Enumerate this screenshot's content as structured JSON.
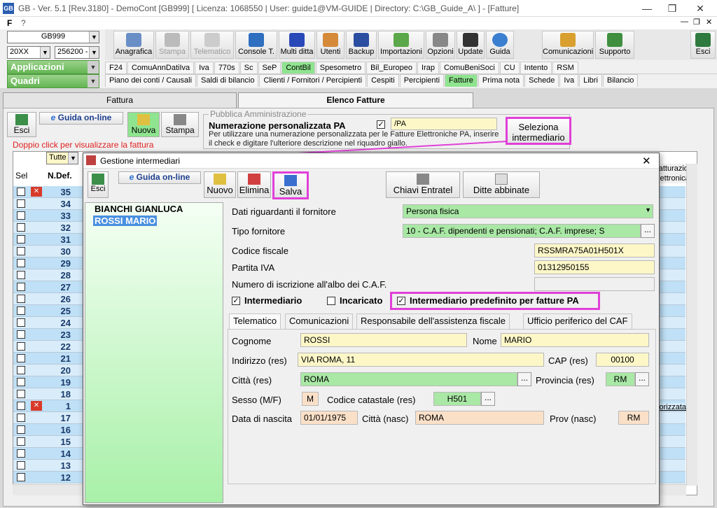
{
  "window": {
    "title": "GB - Ver. 5.1 [Rev.3180] - DemoCont [GB999]    [ Licenza: 1068550 | User: guide1@VM-GUIDE | Directory: C:\\GB_Guide_A\\ ] - [Fatture]",
    "menu_f": "F",
    "menu_q": "?"
  },
  "top_left": {
    "company": "GB999",
    "year": "20XX",
    "code": "256200 -",
    "applicazioni": "Applicazioni",
    "quadri": "Quadri"
  },
  "toolbar": [
    "Anagrafica",
    "Stampa",
    "Telematico",
    "Console T.",
    "Multi ditta",
    "Utenti",
    "Backup",
    "Importazioni",
    "Opzioni",
    "Update",
    "Guida",
    "Comunicazioni",
    "Supporto",
    "Esci"
  ],
  "tabs_row1": [
    "F24",
    "ComuAnnDatiIva",
    "Iva",
    "770s",
    "Sc",
    "SeP",
    "ContBil",
    "Spesometro",
    "Bil_Europeo",
    "Irap",
    "ComuBeniSoci",
    "CU",
    "Intento",
    "RSM"
  ],
  "tabs_row2": [
    "Piano dei conti / Causali",
    "Saldi di bilancio",
    "Clienti / Fornitori / Percipienti",
    "Cespiti",
    "Percipienti",
    "Fatture",
    "Prima nota",
    "Schede",
    "Iva",
    "Libri",
    "Bilancio"
  ],
  "main_tabs": [
    "Fattura",
    "Elenco Fatture"
  ],
  "main": {
    "esci": "Esci",
    "guida": "Guida on-line",
    "nuova": "Nuova",
    "stampa": "Stampa",
    "hint": "Doppio click per visualizzare la fattura",
    "filter": "Tutte",
    "col_sel": "Sel",
    "col_ndef": "N.Def.",
    "right_header": "Fatturazione elettronica",
    "right_cell": "Fattura autorizzata"
  },
  "pa": {
    "group_title": "Pubblica Amministrazione",
    "numbering_label": "Numerazione personalizzata PA",
    "numbering_checked": "✓",
    "numbering_value": "/PA",
    "description": "Per utilizzare una numerazione personalizzata per le Fatture Elettroniche PA, inserire il check e digitare l'ulteriore descrizione nel riquadro giallo.",
    "select_btn_line1": "Seleziona",
    "select_btn_line2": "intermediario"
  },
  "rows": [
    "35",
    "34",
    "33",
    "32",
    "31",
    "30",
    "29",
    "28",
    "27",
    "26",
    "25",
    "24",
    "23",
    "22",
    "21",
    "20",
    "19",
    "18",
    "1",
    "17",
    "16",
    "15",
    "14",
    "13",
    "12"
  ],
  "modal": {
    "title": "Gestione intermediari",
    "buttons": {
      "esci": "Esci",
      "guida": "Guida on-line",
      "nuovo": "Nuovo",
      "elimina": "Elimina",
      "salva": "Salva",
      "chiavi": "Chiavi Entratel",
      "ditte": "Ditte abbinate"
    },
    "list": [
      "BIANCHI GIANLUCA",
      "ROSSI MARIO"
    ],
    "labels": {
      "dati": "Dati riguardanti il fornitore",
      "tipo": "Tipo fornitore",
      "cf": "Codice fiscale",
      "piva": "Partita IVA",
      "albo": "Numero di iscrizione all'albo dei C.A.F.",
      "intermediario": "Intermediario",
      "incaricato": "Incaricato",
      "predefinito": "Intermediario predefinito per fatture PA"
    },
    "values": {
      "dati": "Persona fisica",
      "tipo": "10 - C.A.F. dipendenti e pensionati; C.A.F. imprese; S",
      "cf": "RSSMRA75A01H501X",
      "piva": "01312950155",
      "albo": ""
    },
    "checks": {
      "intermediario": "✓",
      "incaricato": "",
      "predefinito": "✓"
    },
    "inner_tabs": [
      "Telematico",
      "Comunicazioni",
      "Responsabile dell'assistenza fiscale",
      "Ufficio periferico del CAF"
    ],
    "telematico": {
      "cognome_l": "Cognome",
      "cognome": "ROSSI",
      "nome_l": "Nome",
      "nome": "MARIO",
      "indirizzo_l": "Indirizzo (res)",
      "indirizzo": "VIA ROMA, 11",
      "cap_l": "CAP (res)",
      "cap": "00100",
      "citta_l": "Città (res)",
      "citta": "ROMA",
      "prov_l": "Provincia (res)",
      "prov": "RM",
      "sesso_l": "Sesso (M/F)",
      "sesso": "M",
      "catastale_l": "Codice catastale (res)",
      "catastale": "H501",
      "nascita_l": "Data di nascita",
      "nascita": "01/01/1975",
      "citta_nasc_l": "Città (nasc)",
      "citta_nasc": "ROMA",
      "prov_nasc_l": "Prov (nasc)",
      "prov_nasc": "RM"
    }
  },
  "colors": {
    "accent": "#e040d8",
    "selected_tab": "#8fe48f",
    "yellow_field": "#fdf7c8",
    "green_field": "#a9e8a5"
  }
}
